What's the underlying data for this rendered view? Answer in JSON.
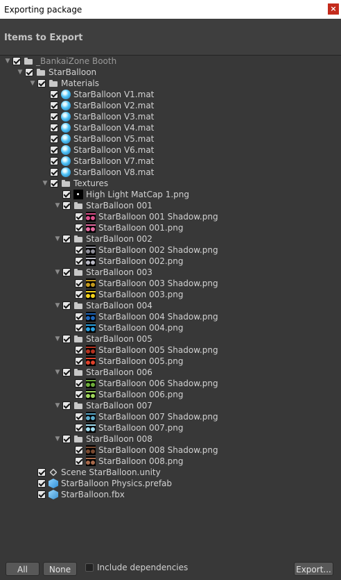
{
  "window": {
    "title": "Exporting package",
    "close": "×"
  },
  "header": {
    "title": "Items to Export"
  },
  "tree": [
    {
      "label": "_BankaiZone Booth",
      "indent": 0,
      "fold": "open",
      "icon": "folder",
      "dim": true
    },
    {
      "label": "StarBalloon",
      "indent": 1,
      "fold": "open",
      "icon": "folder"
    },
    {
      "label": "Materials",
      "indent": 2,
      "fold": "open",
      "icon": "folder"
    },
    {
      "label": "StarBalloon V1.mat",
      "indent": 3,
      "icon": "mat"
    },
    {
      "label": "StarBalloon V2.mat",
      "indent": 3,
      "icon": "mat"
    },
    {
      "label": "StarBalloon V3.mat",
      "indent": 3,
      "icon": "mat"
    },
    {
      "label": "StarBalloon V4.mat",
      "indent": 3,
      "icon": "mat"
    },
    {
      "label": "StarBalloon V5.mat",
      "indent": 3,
      "icon": "mat"
    },
    {
      "label": "StarBalloon V6.mat",
      "indent": 3,
      "icon": "mat"
    },
    {
      "label": "StarBalloon V7.mat",
      "indent": 3,
      "icon": "mat"
    },
    {
      "label": "StarBalloon V8.mat",
      "indent": 3,
      "icon": "mat"
    },
    {
      "label": "Textures",
      "indent": 3,
      "fold": "open",
      "icon": "folder"
    },
    {
      "label": "High Light MatCap 1.png",
      "indent": 4,
      "icon": "matcap"
    },
    {
      "label": "StarBalloon 001",
      "indent": 4,
      "fold": "open",
      "icon": "folder"
    },
    {
      "label": "StarBalloon 001 Shadow.png",
      "indent": 5,
      "icon": "tex",
      "color": "#d94f8a"
    },
    {
      "label": "StarBalloon 001.png",
      "indent": 5,
      "icon": "tex",
      "color": "#e46aa0"
    },
    {
      "label": "StarBalloon 002",
      "indent": 4,
      "fold": "open",
      "icon": "folder"
    },
    {
      "label": "StarBalloon 002 Shadow.png",
      "indent": 5,
      "icon": "tex",
      "color": "#8f8f9a"
    },
    {
      "label": "StarBalloon 002.png",
      "indent": 5,
      "icon": "tex",
      "color": "#b9b9c4"
    },
    {
      "label": "StarBalloon 003",
      "indent": 4,
      "fold": "open",
      "icon": "folder"
    },
    {
      "label": "StarBalloon 003 Shadow.png",
      "indent": 5,
      "icon": "tex",
      "color": "#c59a1c"
    },
    {
      "label": "StarBalloon 003.png",
      "indent": 5,
      "icon": "tex",
      "color": "#f2d21a"
    },
    {
      "label": "StarBalloon 004",
      "indent": 4,
      "fold": "open",
      "icon": "folder"
    },
    {
      "label": "StarBalloon 004 Shadow.png",
      "indent": 5,
      "icon": "tex",
      "color": "#1d64b8"
    },
    {
      "label": "StarBalloon 004.png",
      "indent": 5,
      "icon": "tex",
      "color": "#2aa0e0"
    },
    {
      "label": "StarBalloon 005",
      "indent": 4,
      "fold": "open",
      "icon": "folder"
    },
    {
      "label": "StarBalloon 005 Shadow.png",
      "indent": 5,
      "icon": "tex",
      "color": "#b5321f"
    },
    {
      "label": "StarBalloon 005.png",
      "indent": 5,
      "icon": "tex",
      "color": "#e0412a"
    },
    {
      "label": "StarBalloon 006",
      "indent": 4,
      "fold": "open",
      "icon": "folder"
    },
    {
      "label": "StarBalloon 006 Shadow.png",
      "indent": 5,
      "icon": "tex",
      "color": "#6eae3a"
    },
    {
      "label": "StarBalloon 006.png",
      "indent": 5,
      "icon": "tex",
      "color": "#9fd65a"
    },
    {
      "label": "StarBalloon 007",
      "indent": 4,
      "fold": "open",
      "icon": "folder"
    },
    {
      "label": "StarBalloon 007 Shadow.png",
      "indent": 5,
      "icon": "tex",
      "color": "#5aa8c8"
    },
    {
      "label": "StarBalloon 007.png",
      "indent": 5,
      "icon": "tex",
      "color": "#9fdcf0"
    },
    {
      "label": "StarBalloon 008",
      "indent": 4,
      "fold": "open",
      "icon": "folder"
    },
    {
      "label": "StarBalloon 008 Shadow.png",
      "indent": 5,
      "icon": "tex",
      "color": "#7a4a30"
    },
    {
      "label": "StarBalloon 008.png",
      "indent": 5,
      "icon": "tex",
      "color": "#a8694a"
    },
    {
      "label": "Scene StarBalloon.unity",
      "indent": 2,
      "icon": "scene"
    },
    {
      "label": "StarBalloon Physics.prefab",
      "indent": 2,
      "icon": "prefab"
    },
    {
      "label": "StarBalloon.fbx",
      "indent": 2,
      "icon": "fbx"
    }
  ],
  "footer": {
    "all_label": "All",
    "none_label": "None",
    "include_label": "Include dependencies",
    "export_label": "Export..."
  }
}
